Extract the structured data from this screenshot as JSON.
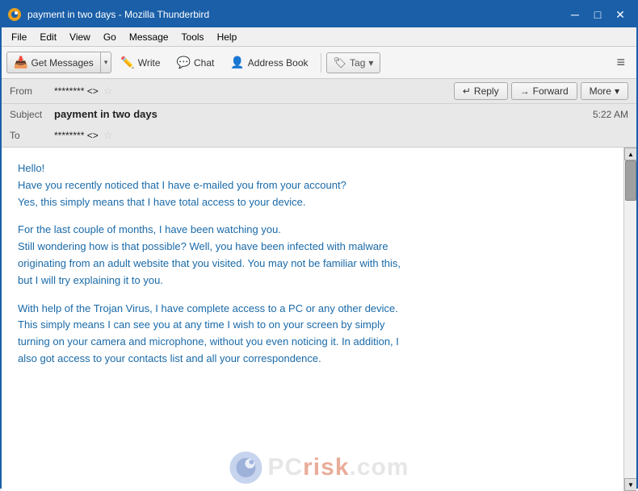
{
  "window": {
    "title": "payment in two days - Mozilla Thunderbird",
    "minimize_label": "─",
    "maximize_label": "□",
    "close_label": "✕"
  },
  "menu": {
    "items": [
      "File",
      "Edit",
      "View",
      "Go",
      "Message",
      "Tools",
      "Help"
    ]
  },
  "toolbar": {
    "get_messages": "Get Messages",
    "write": "Write",
    "chat": "Chat",
    "address_book": "Address Book",
    "tag": "Tag",
    "tag_dropdown": "▾",
    "menu_icon": "≡"
  },
  "email_header": {
    "from_label": "From",
    "from_value": "******** <>",
    "subject_label": "Subject",
    "subject_value": "payment in two days",
    "subject_time": "5:22 AM",
    "to_label": "To",
    "to_value": "******** <>",
    "reply_label": "Reply",
    "forward_label": "Forward",
    "more_label": "More",
    "more_dropdown": "▾"
  },
  "email_body": {
    "paragraphs": [
      "Hello!\nHave you recently noticed that I have e-mailed you from your account?\nYes, this simply means that I have total access to your device.",
      "For the last couple of months, I have been watching you.\nStill wondering how is that possible? Well, you have been infected with malware\noriginating from an adult website that you visited. You may not be familiar with this,\nbut I will try explaining it to you.",
      "With help of the Trojan Virus, I have complete access to a PC or any other device.\nThis simply means I can see you at any time I wish to on your screen by simply\nturning on your camera and microphone, without you even noticing it. In addition, I\nalso got access to your contacts list and all your correspondence."
    ]
  },
  "watermark": {
    "text_pc": "PC",
    "text_risk": "risk",
    "text_com": ".com"
  },
  "icons": {
    "reply": "↵",
    "forward": "→",
    "get_messages": "📥",
    "write": "✏",
    "chat": "💬",
    "address_book": "👤",
    "tag": "🏷",
    "star": "☆",
    "arrow_up": "▲",
    "arrow_down": "▼",
    "thunderbird": "🦅"
  }
}
